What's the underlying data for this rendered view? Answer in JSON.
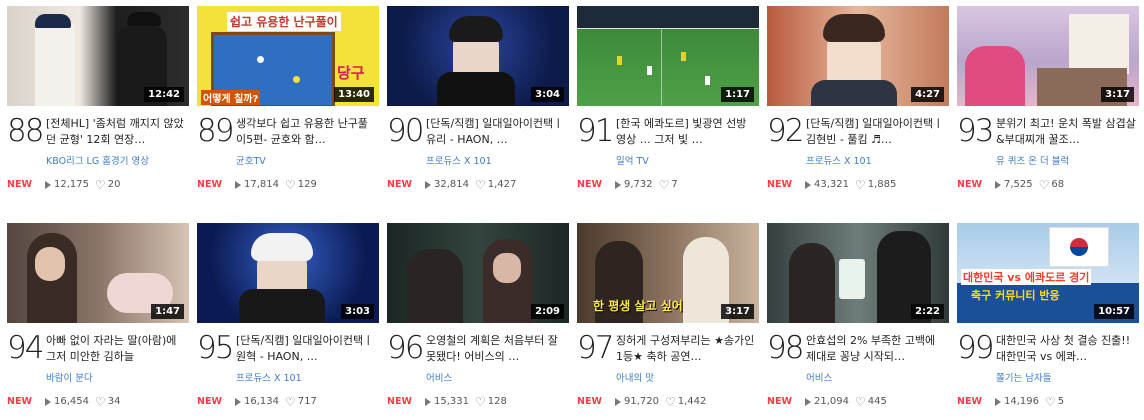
{
  "cards": [
    {
      "rank": "88",
      "duration": "12:42",
      "title": "[전체HL] '좀처럼 깨지지 않았던 균형' 12회 연장…",
      "channel": "KBO리그 LG 홈경기 영상",
      "views": "12,175",
      "likes": "20",
      "is_new": "NEW",
      "thumb_colors": [
        "#2a2a2a",
        "#e8e4de"
      ]
    },
    {
      "rank": "89",
      "duration": "13:40",
      "title": "생각보다 쉽고 유용한 난구풀이5편- 균호와 함…",
      "channel": "균호TV",
      "views": "17,814",
      "likes": "129",
      "is_new": "NEW",
      "thumb_colors": [
        "#f5e63a",
        "#2d6bbf"
      ]
    },
    {
      "rank": "90",
      "duration": "3:04",
      "title": "[단독/직캠] 일대일아이컨택ㅣ유리 - HAON, …",
      "channel": "프로듀스 X 101",
      "views": "32,814",
      "likes": "1,427",
      "is_new": "NEW",
      "thumb_colors": [
        "#0d1b4a",
        "#1f3480"
      ]
    },
    {
      "rank": "91",
      "duration": "1:17",
      "title": "[한국 에콰도르] 빛광연 선방 영상 … 그저 빛 …",
      "channel": "일억 TV",
      "views": "9,732",
      "likes": "7",
      "is_new": "NEW",
      "thumb_colors": [
        "#2f7a2e",
        "#4c9b45"
      ]
    },
    {
      "rank": "92",
      "duration": "4:27",
      "title": "[단독/직캠] 일대일아이컨택ㅣ김현빈 - 풀킴 ♬…",
      "channel": "프로듀스 X 101",
      "views": "43,321",
      "likes": "1,885",
      "is_new": "NEW",
      "thumb_colors": [
        "#c98b7a",
        "#e8c9b8"
      ]
    },
    {
      "rank": "93",
      "duration": "3:17",
      "title": "분위기 최고! 운치 폭발 삼겹살&부대찌개 꿀조…",
      "channel": "유 퀴즈 온 더 블럭",
      "views": "7,525",
      "likes": "68",
      "is_new": "NEW",
      "thumb_colors": [
        "#b8a1c8",
        "#e6b7d6"
      ]
    },
    {
      "rank": "94",
      "duration": "1:47",
      "title": "아빠 없이 자라는 딸(아람)에 그저 미안한 김하늘",
      "channel": "바람이 분다",
      "views": "16,454",
      "likes": "34",
      "is_new": "NEW",
      "thumb_colors": [
        "#6a5a54",
        "#c7b3a6"
      ]
    },
    {
      "rank": "95",
      "duration": "3:03",
      "title": "[단독/직캠] 일대일아이컨택ㅣ원혁 - HAON, …",
      "channel": "프로듀스 X 101",
      "views": "16,134",
      "likes": "717",
      "is_new": "NEW",
      "thumb_colors": [
        "#0b1a52",
        "#2548a8"
      ]
    },
    {
      "rank": "96",
      "duration": "2:09",
      "title": "오영철의 계획은 처음부터 잘못됐다! 어비스의 …",
      "channel": "어비스",
      "views": "15,331",
      "likes": "128",
      "is_new": "NEW",
      "thumb_colors": [
        "#1c2a2a",
        "#3a4a46"
      ]
    },
    {
      "rank": "97",
      "duration": "3:17",
      "title": "징허게 구성져부리는 ★송가인 1등★ 축하 공연…",
      "channel": "아내의 맛",
      "views": "91,720",
      "likes": "1,442",
      "is_new": "NEW",
      "thumb_colors": [
        "#5a4638",
        "#a08670"
      ]
    },
    {
      "rank": "98",
      "duration": "2:22",
      "title": "안효섭의 2% 부족한 고백에 제대로 꽁냥 시작되…",
      "channel": "어비스",
      "views": "21,094",
      "likes": "445",
      "is_new": "NEW",
      "thumb_colors": [
        "#2d3a3a",
        "#6b7b7a"
      ]
    },
    {
      "rank": "99",
      "duration": "10:57",
      "title": "대한민국 사상 첫 결승 진출!! 대한민국 vs 에콰…",
      "channel": "쫄기는 남자들",
      "views": "14,196",
      "likes": "5",
      "is_new": "NEW",
      "thumb_colors": [
        "#8fb8de",
        "#ffffff"
      ]
    }
  ],
  "thumb_texts": {
    "billiards_top": "쉽고 유용한 난구풀이",
    "billiards_side": "당구",
    "billiards_bottom": "어떻게 칠까?",
    "song_caption": "한 평생 살고 싶어",
    "soccer_banner": "대한민국 vs 에콰도르 경기",
    "soccer_banner2": "축구 커뮤니티 반응"
  }
}
